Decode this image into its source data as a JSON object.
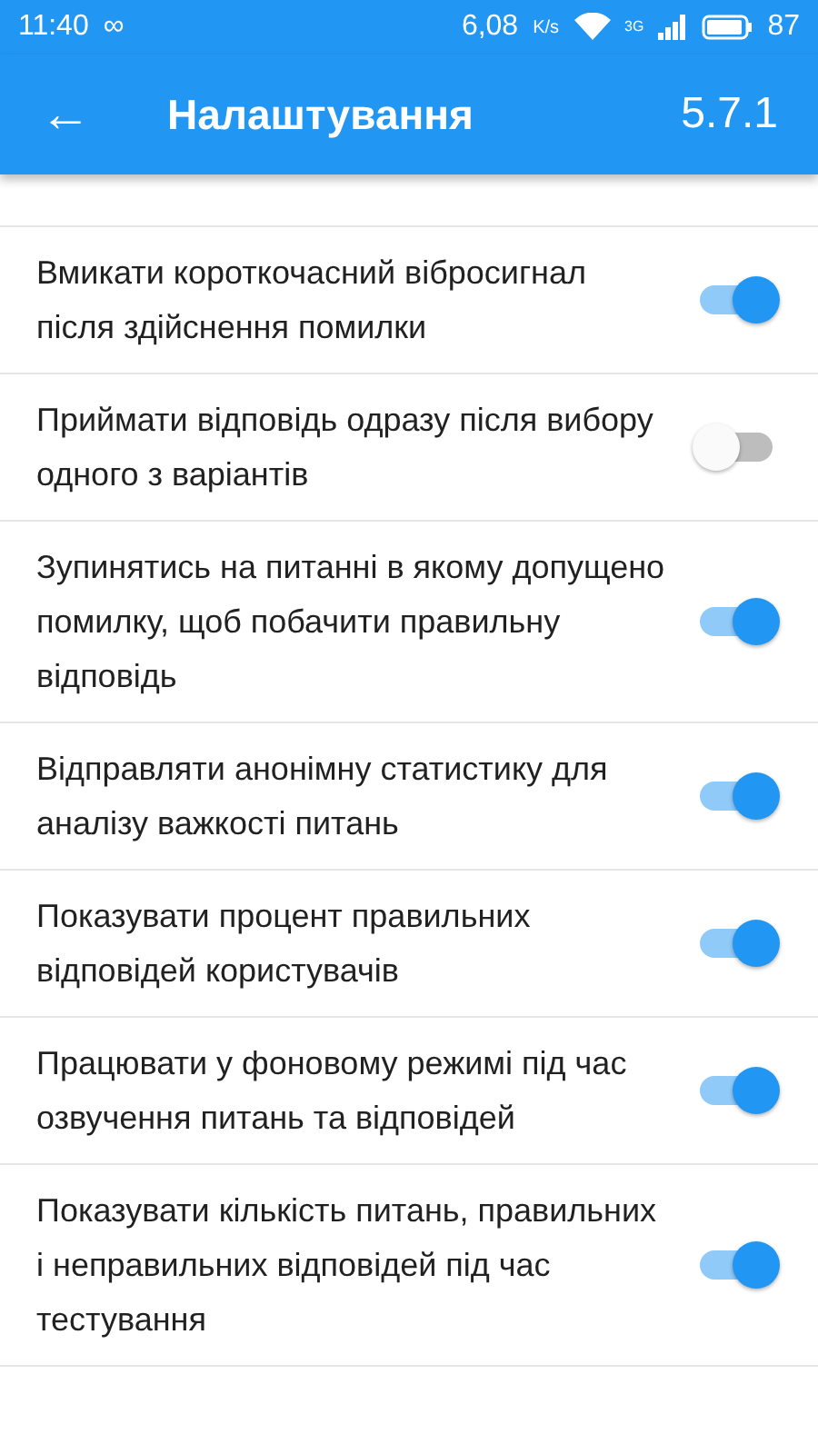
{
  "status_bar": {
    "time": "11:40",
    "loop_glyph": "∞",
    "speed": "6,08",
    "speed_unit": "K/s",
    "network": "3G",
    "battery": "87"
  },
  "app_bar": {
    "back_glyph": "←",
    "title": "Налаштування",
    "version": "5.7.1"
  },
  "settings": [
    {
      "label": "Вмикати короткочасний вібросигнал після здійснення помилки",
      "on": true
    },
    {
      "label": "Приймати відповідь одразу після вибору одного з варіантів",
      "on": false
    },
    {
      "label": "Зупинятись на питанні в якому допущено помилку, щоб побачити правильну відповідь",
      "on": true
    },
    {
      "label": "Відправляти анонімну статистику для аналізу важкості питань",
      "on": true
    },
    {
      "label": "Показувати процент правильних відповідей користувачів",
      "on": true
    },
    {
      "label": "Працювати у фоновому режимі під час озвучення питань та відповідей",
      "on": true
    },
    {
      "label": "Показувати кількість питань, правильних і неправильних відповідей під час тестування",
      "on": true
    }
  ]
}
